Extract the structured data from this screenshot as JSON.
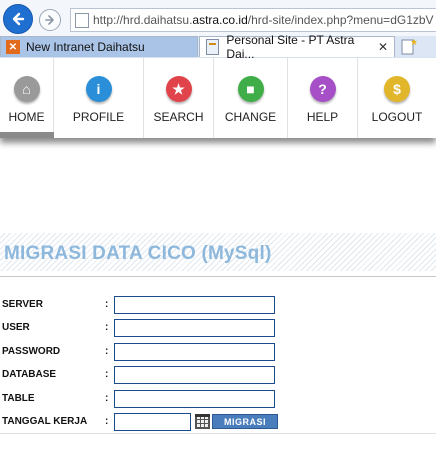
{
  "browser": {
    "url_prefix": "http://hrd.daihatsu.",
    "url_domain": "astra.co.id",
    "url_suffix": "/hrd-site/index.php?menu=dG1zbV",
    "tabs": [
      {
        "title": "New Intranet Daihatsu",
        "favicon": "x-favicon"
      },
      {
        "title": "Personal Site - PT Astra Dai...",
        "favicon": "page-favicon",
        "close": "✕"
      }
    ]
  },
  "menu": {
    "items": [
      {
        "label": "HOME",
        "icon": "home-icon",
        "color": "#9a9a9a",
        "glyph": "⌂"
      },
      {
        "label": "PROFILE",
        "icon": "info-icon",
        "color": "#2a8fd8",
        "glyph": "i"
      },
      {
        "label": "SEARCH",
        "icon": "star-icon",
        "color": "#e0434a",
        "glyph": "★"
      },
      {
        "label": "CHANGE",
        "icon": "save-icon",
        "color": "#3fae49",
        "glyph": "■"
      },
      {
        "label": "HELP",
        "icon": "help-icon",
        "color": "#a64fc6",
        "glyph": "?"
      },
      {
        "label": "LOGOUT",
        "icon": "dollar-icon",
        "color": "#e2b62a",
        "glyph": "$"
      }
    ]
  },
  "page": {
    "heading": "MIGRASI DATA CICO (MySql)",
    "form": {
      "colon": ":",
      "fields": [
        {
          "label": "SERVER",
          "value": ""
        },
        {
          "label": "USER",
          "value": ""
        },
        {
          "label": "PASSWORD",
          "value": ""
        },
        {
          "label": "DATABASE",
          "value": ""
        },
        {
          "label": "TABLE",
          "value": ""
        },
        {
          "label": "TANGGAL KERJA",
          "value": ""
        }
      ],
      "submit_label": "MIGRASI"
    }
  }
}
